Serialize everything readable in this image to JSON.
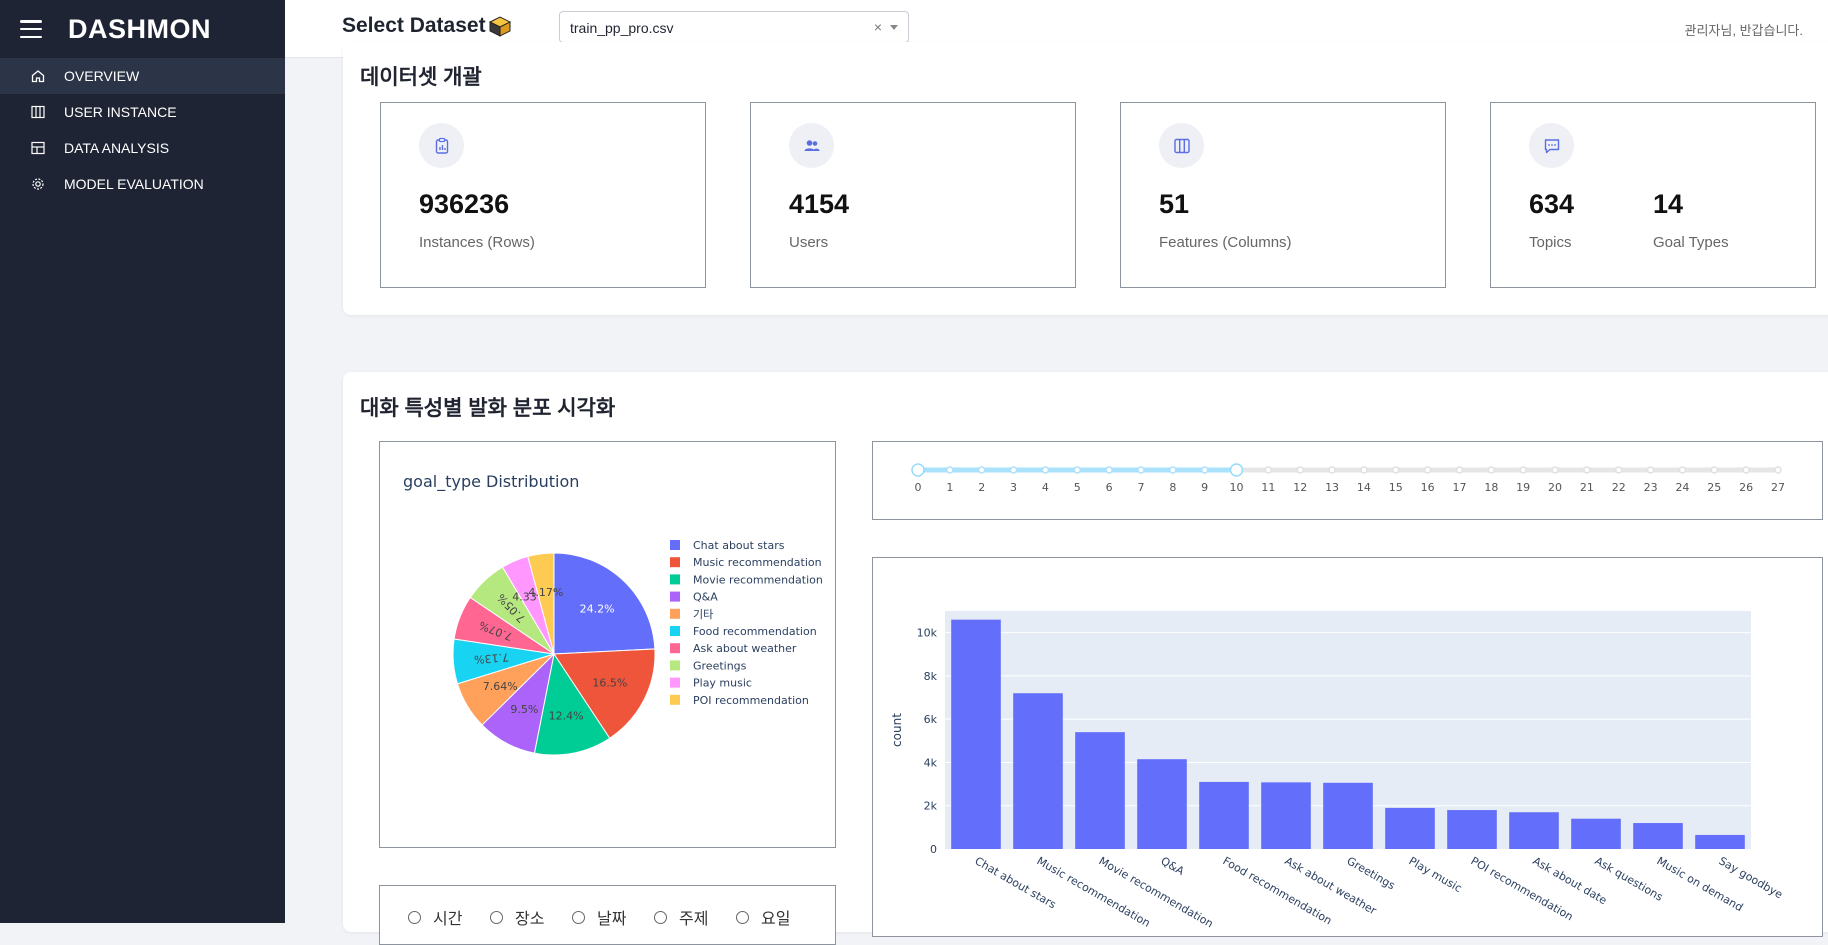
{
  "sidebar": {
    "brand": "DASHMON",
    "items": [
      {
        "label": "OVERVIEW",
        "icon": "home-icon",
        "active": true
      },
      {
        "label": "USER INSTANCE",
        "icon": "columns-icon"
      },
      {
        "label": "DATA ANALYSIS",
        "icon": "layout-icon"
      },
      {
        "label": "MODEL EVALUATION",
        "icon": "gear-icon"
      }
    ]
  },
  "header": {
    "title": "Select Dataset",
    "dataset_value": "train_pp_pro.csv",
    "clear_label": "×",
    "greeting": "관리자님, 반갑습니다."
  },
  "overview": {
    "title": "데이터셋 개괄",
    "stats": [
      {
        "value": "936236",
        "label": "Instances (Rows)",
        "icon": "clipboard-chart-icon"
      },
      {
        "value": "4154",
        "label": "Users",
        "icon": "users-icon"
      },
      {
        "value": "51",
        "label": "Features (Columns)",
        "icon": "columns-icon"
      },
      {
        "value": "634",
        "label": "Topics",
        "icon": "chat-icon"
      },
      {
        "value": "14",
        "label": "Goal Types"
      }
    ]
  },
  "distribution": {
    "title": "대화 특성별 발화 분포 시각화",
    "pie_title": "goal_type Distribution",
    "slider": {
      "min": 0,
      "max": 27,
      "range": [
        0,
        10
      ],
      "ticks": [
        "0",
        "1",
        "2",
        "3",
        "4",
        "5",
        "6",
        "7",
        "8",
        "9",
        "10",
        "11",
        "12",
        "13",
        "14",
        "15",
        "16",
        "17",
        "18",
        "19",
        "20",
        "21",
        "22",
        "23",
        "24",
        "25",
        "26",
        "27"
      ]
    },
    "radios": [
      "시간",
      "장소",
      "날짜",
      "주제",
      "요일"
    ]
  },
  "chart_data": [
    {
      "type": "pie",
      "title": "goal_type Distribution",
      "labels": [
        "Chat about stars",
        "Music recommendation",
        "Movie recommendation",
        "Q&A",
        "기타",
        "Food recommendation",
        "Ask about weather",
        "Greetings",
        "Play music",
        "POI recommendation"
      ],
      "values": [
        24.2,
        16.5,
        12.4,
        9.5,
        7.64,
        7.13,
        7.07,
        7.05,
        4.33,
        4.17
      ],
      "value_labels": [
        "24.2%",
        "16.5%",
        "12.4%",
        "9.5%",
        "7.64%",
        "7.13%",
        "7.07%",
        "7.05%",
        "4.33%",
        "4.17%"
      ],
      "colors": [
        "#636efa",
        "#ef553b",
        "#00cc96",
        "#ab63fa",
        "#ffa15a",
        "#19d3f3",
        "#ff6692",
        "#b6e880",
        "#ff97ff",
        "#fecb52"
      ],
      "legend": "right"
    },
    {
      "type": "bar",
      "categories": [
        "Chat about stars",
        "Music recommendation",
        "Movie recommendation",
        "Q&A",
        "Food recommendation",
        "Ask about weather",
        "Greetings",
        "Play music",
        "POI recommendation",
        "Ask about date",
        "Ask questions",
        "Music on demand",
        "Say goodbye"
      ],
      "values": [
        10600,
        7200,
        5400,
        4150,
        3100,
        3080,
        3060,
        1900,
        1800,
        1700,
        1400,
        1200,
        650
      ],
      "ylabel": "count",
      "ylim": [
        0,
        11000
      ],
      "yticks": [
        0,
        2000,
        4000,
        6000,
        8000,
        10000
      ],
      "ytick_labels": [
        "0",
        "2k",
        "4k",
        "6k",
        "8k",
        "10k"
      ],
      "color": "#636efa",
      "grid": true
    }
  ]
}
